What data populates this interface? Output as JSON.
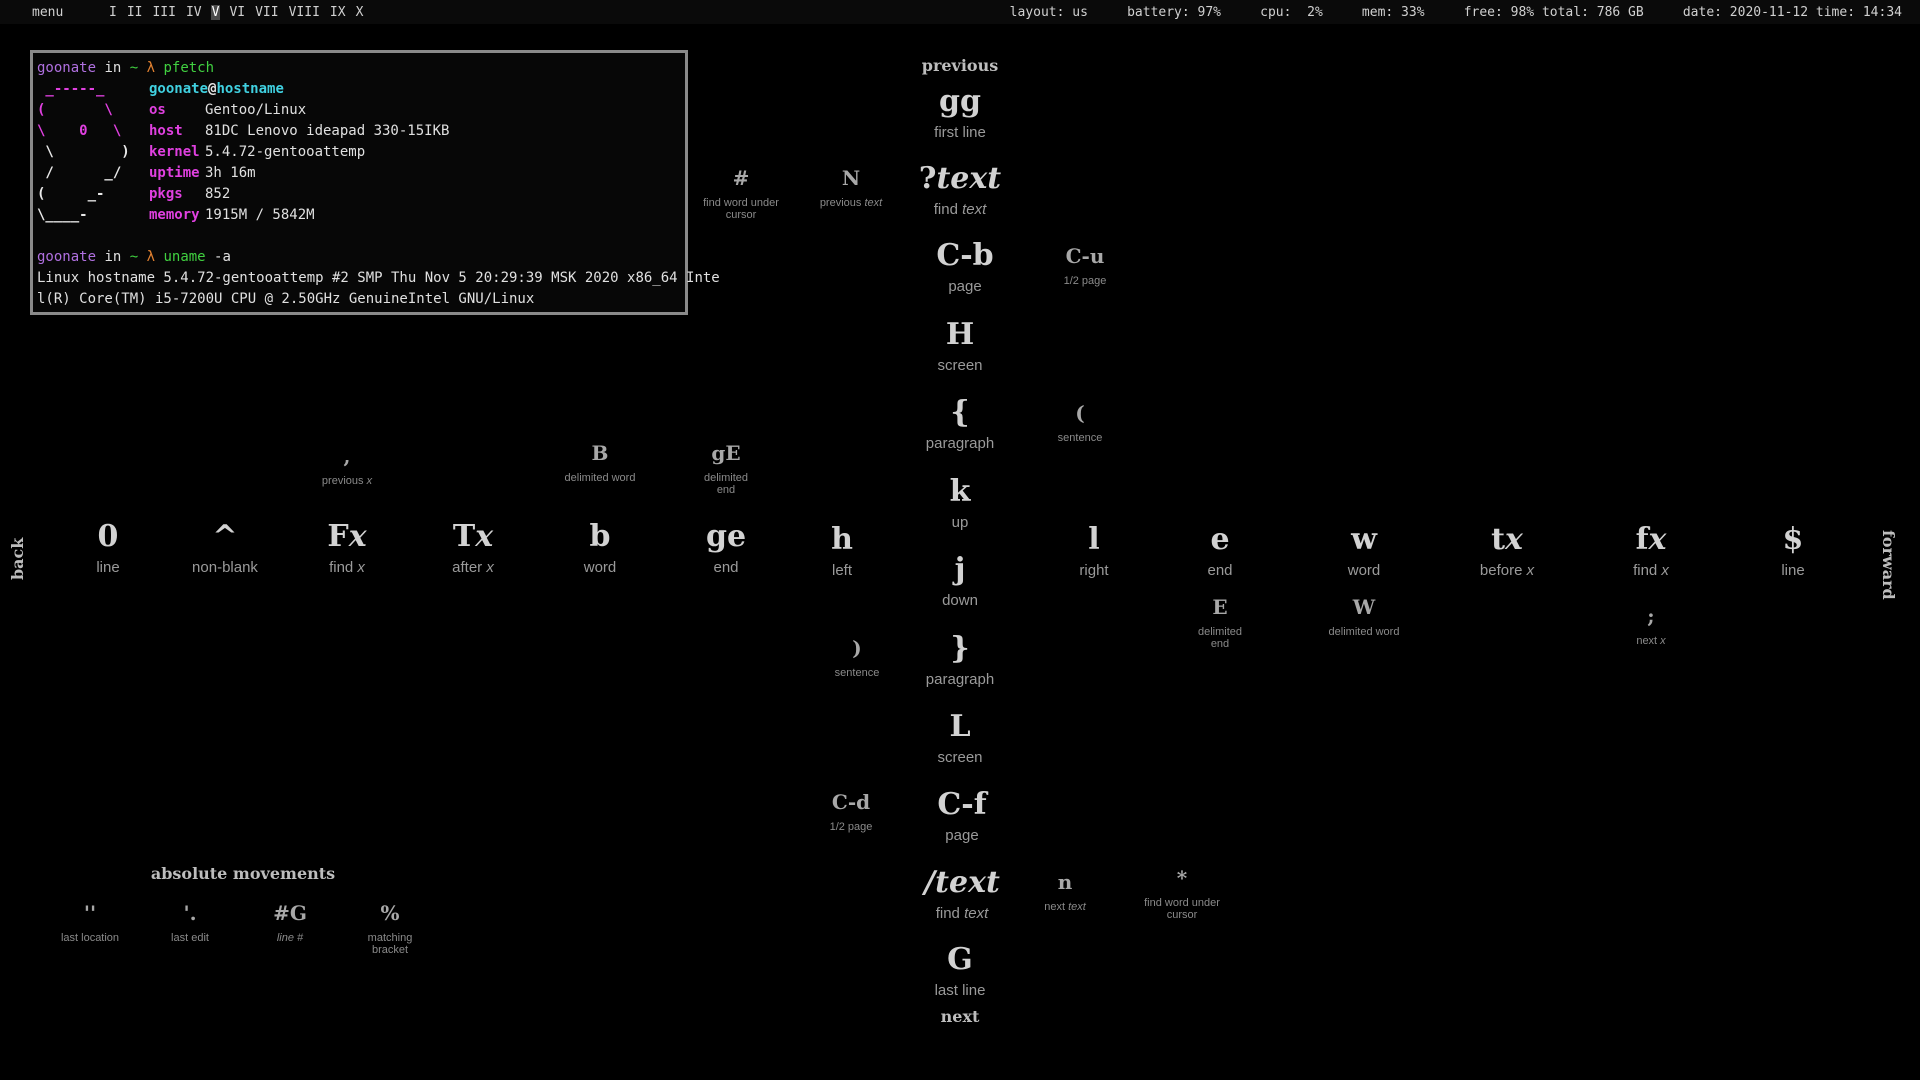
{
  "topbar": {
    "menu": "menu",
    "workspaces": [
      "I",
      "II",
      "III",
      "IV",
      "V",
      "VI",
      "VII",
      "VIII",
      "IX",
      "X"
    ],
    "active_workspace": "V",
    "layout": "layout: us",
    "battery": "battery: 97%",
    "cpu": "cpu:  2%",
    "mem": "mem: 33%",
    "disk": "free: 98% total: 786 GB",
    "datetime": "date: 2020-11-12 time: 14:34"
  },
  "terminal": {
    "user": "goonate",
    "in": " in ",
    "dir": "~",
    "prompt": " λ ",
    "cmd1": "pfetch",
    "host_user": "goonate",
    "at": "@",
    "hostname": "hostname",
    "art": [
      " _-----_",
      "(       \\",
      "\\    0   \\",
      " \\        )",
      " /      _/",
      "(     _-",
      "\\____-"
    ],
    "info": [
      {
        "label": "os",
        "value": "Gentoo/Linux"
      },
      {
        "label": "host",
        "value": "81DC Lenovo ideapad 330-15IKB"
      },
      {
        "label": "kernel",
        "value": "5.4.72-gentooattemp"
      },
      {
        "label": "uptime",
        "value": "3h 16m"
      },
      {
        "label": "pkgs",
        "value": "852"
      },
      {
        "label": "memory",
        "value": "1915M / 5842M"
      }
    ],
    "cmd2": "uname",
    "cmd2_args": " -a",
    "out1": "Linux hostname 5.4.72-gentooattemp #2 SMP Thu Nov 5 20:29:39 MSK 2020 x86_64 Inte",
    "out2": "l(R) Core(TM) i5-7200U CPU @ 2.50GHz GenuineIntel GNU/Linux"
  },
  "labels": {
    "previous": "previous",
    "next": "next",
    "back": "back",
    "forward": "forward",
    "absolute": "absolute movements"
  },
  "vertical": {
    "gg": {
      "key": "gg",
      "desc": "first line"
    },
    "qtext_q": "?",
    "qtext_t": "text",
    "qtext_d1": "find ",
    "qtext_d2": "text",
    "cb": {
      "key": "C-b",
      "desc": "page"
    },
    "H": {
      "key": "H",
      "desc": "screen"
    },
    "brace_open": {
      "key": "{",
      "desc": "paragraph"
    },
    "k": {
      "key": "k",
      "desc": "up"
    },
    "j": {
      "key": "j",
      "desc": "down"
    },
    "brace_close": {
      "key": "}",
      "desc": "paragraph"
    },
    "L": {
      "key": "L",
      "desc": "screen"
    },
    "cf": {
      "key": "C-f",
      "desc": "page"
    },
    "stext_s": "/",
    "stext_t": "text",
    "stext_d1": "find ",
    "stext_d2": "text",
    "G": {
      "key": "G",
      "desc": "last line"
    }
  },
  "side": {
    "hash": {
      "key": "#",
      "desc1": "find word under",
      "desc2": "cursor"
    },
    "N_key": "N",
    "N_d1": "previous ",
    "N_d2": "text",
    "cu": {
      "key": "C-u",
      "desc": "1/2 page"
    },
    "paren_open": {
      "key": "(",
      "desc": "sentence"
    },
    "paren_close": {
      "key": ")",
      "desc": "sentence"
    },
    "cd": {
      "key": "C-d",
      "desc": "1/2 page"
    },
    "n_key": "n",
    "n_d1": "next ",
    "n_d2": "text",
    "star": {
      "key": "*",
      "desc1": "find word under",
      "desc2": "cursor"
    }
  },
  "horizontal": {
    "zero": {
      "key": "0",
      "desc": "line"
    },
    "caret": {
      "key": "^",
      "desc": "non-blank"
    },
    "Fx_F": "F",
    "Fx_x": "x",
    "Fx_d1": "find ",
    "Fx_d2": "x",
    "Tx_T": "T",
    "Tx_x": "x",
    "Tx_d1": "after ",
    "Tx_d2": "x",
    "b": {
      "key": "b",
      "desc": "word"
    },
    "ge": {
      "key": "ge",
      "desc": "end"
    },
    "h": {
      "key": "h",
      "desc": "left"
    },
    "l": {
      "key": "l",
      "desc": "right"
    },
    "e": {
      "key": "e",
      "desc": "end"
    },
    "w": {
      "key": "w",
      "desc": "word"
    },
    "tx_t": "t",
    "tx_x": "x",
    "tx_d1": "before ",
    "tx_d2": "x",
    "fx_f": "f",
    "fx_x": "x",
    "fx_d1": "find ",
    "fx_d2": "x",
    "dollar": {
      "key": "$",
      "desc": "line"
    }
  },
  "secondary": {
    "comma_key": ",",
    "comma_d1": "previous ",
    "comma_d2": "x",
    "B": {
      "key": "B",
      "desc": "delimited word"
    },
    "gE": {
      "key": "gE",
      "desc1": "delimited",
      "desc2": "end"
    },
    "E": {
      "key": "E",
      "desc1": "delimited",
      "desc2": "end"
    },
    "W": {
      "key": "W",
      "desc": "delimited word"
    },
    "semi_key": ";",
    "semi_d1": "next ",
    "semi_d2": "x"
  },
  "absolute": {
    "last_loc": {
      "key": "''",
      "desc": "last location"
    },
    "last_edit": {
      "key": "'.",
      "desc": "last edit"
    },
    "line_g_key": "#G",
    "line_g_desc": "line #",
    "percent": {
      "key": "%",
      "desc1": "matching",
      "desc2": "bracket"
    }
  }
}
